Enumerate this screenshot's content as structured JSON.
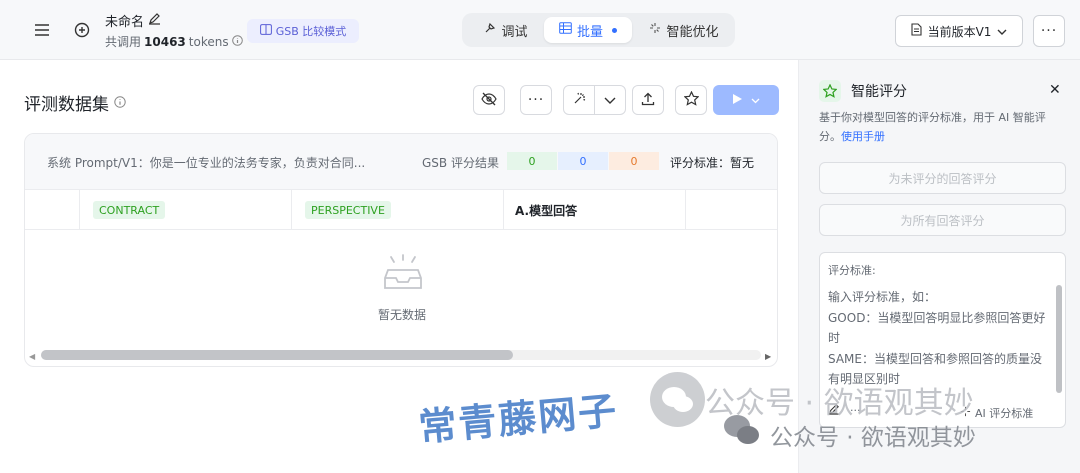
{
  "header": {
    "title": "未命名",
    "tokens_prefix": "共调用",
    "tokens_value": "10463",
    "tokens_suffix": "tokens",
    "gsb_mode_label": "GSB 比较模式",
    "modes": [
      {
        "label": "调试",
        "icon": "debug-icon",
        "active": false
      },
      {
        "label": "批量",
        "icon": "batch-table-icon",
        "active": true
      },
      {
        "label": "智能优化",
        "icon": "sparkle-icon",
        "active": false
      }
    ],
    "version_label": "当前版本V1",
    "more_label": "···"
  },
  "main": {
    "title": "评测数据集",
    "system_prompt": "系统 Prompt/V1：你是一位专业的法务专家，负责对合同...",
    "gsb_result_label": "GSB 评分结果",
    "gsb_scores": {
      "good": "0",
      "same": "0",
      "bad": "0"
    },
    "criteria_label": "评分标准：暂无",
    "columns": [
      "CONTRACT",
      "PERSPECTIVE",
      "A.模型回答"
    ],
    "empty_text": "暂无数据"
  },
  "panel": {
    "title": "智能评分",
    "description": "基于你对模型回答的评分标准，用于 AI 智能评分。",
    "help_link": "使用手册",
    "btn_score_unscored": "为未评分的回答评分",
    "btn_score_all": "为所有回答评分",
    "criteria_box_label": "评分标准:",
    "criteria_text_1": "输入评分标准，如：",
    "criteria_text_2": "GOOD：当模型回答明显比参照回答更好时",
    "criteria_text_3": "SAME：当模型回答和参照回答的质量没有明显区别时",
    "ai_criteria_label": "AI 评分标准"
  },
  "colors": {
    "accent": "#3370ff",
    "good": "#2ea121",
    "bad": "#e57a2e"
  },
  "watermark": {
    "name": "常青藤网子",
    "account_1": "公众号 · 欲语观其妙",
    "account_2": "公众号 · 欲语观其妙"
  }
}
